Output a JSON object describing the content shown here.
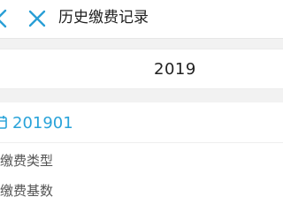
{
  "header": {
    "title": "历史缴费记录"
  },
  "year_selector": {
    "value": "2019"
  },
  "record": {
    "month": "201901",
    "fields": [
      {
        "label": "缴费类型"
      },
      {
        "label": "缴费基数"
      }
    ]
  },
  "colors": {
    "accent": "#29a3d9",
    "background": "#f2f2f2"
  },
  "icons": {
    "back": "chevron-left-icon",
    "close": "close-icon",
    "calendar": "calendar-icon"
  }
}
